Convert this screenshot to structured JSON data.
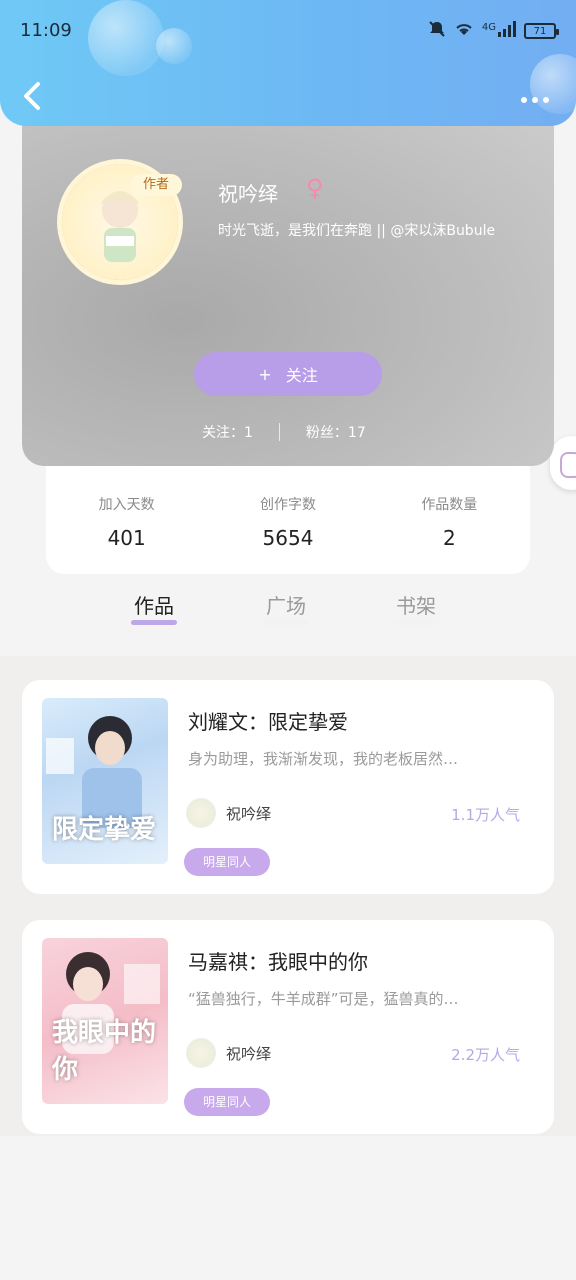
{
  "status_bar": {
    "time": "11:09",
    "network": "4G",
    "battery": "71"
  },
  "profile": {
    "author_tag": "作者",
    "name": "祝吟绎",
    "gender_symbol": "♀",
    "bio": "时光飞逝，是我们在奔跑 || @宋以沫Bubule",
    "follow_plus": "+",
    "follow_label": "关注",
    "following": "关注：1",
    "fans": "粉丝：17"
  },
  "stats": [
    {
      "label": "加入天数",
      "value": "401"
    },
    {
      "label": "创作字数",
      "value": "5654"
    },
    {
      "label": "作品数量",
      "value": "2"
    }
  ],
  "tabs": [
    {
      "label": "作品",
      "active": true
    },
    {
      "label": "广场",
      "active": false
    },
    {
      "label": "书架",
      "active": false
    }
  ],
  "works": [
    {
      "cover_text": "限定挚爱",
      "title": "刘耀文：限定挚爱",
      "excerpt": "身为助理，我渐渐发现，我的老板居然…",
      "author": "祝吟绎",
      "popularity": "1.1万人气",
      "tag": "明星同人"
    },
    {
      "cover_text": "我眼中的你",
      "title": "马嘉祺：我眼中的你",
      "excerpt": "“猛兽独行，牛羊成群”可是，猛兽真的…",
      "author": "祝吟绎",
      "popularity": "2.2万人气",
      "tag": "明星同人"
    }
  ],
  "colors": {
    "accent": "#b89de8",
    "topbar_start": "#6fc9f5",
    "topbar_end": "#73aef2"
  }
}
